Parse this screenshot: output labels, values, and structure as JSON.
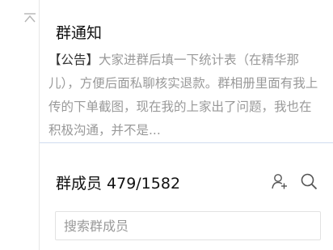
{
  "notice": {
    "title": "群通知",
    "tag": "【公告】",
    "body": "大家进群后填一下统计表（在精华那儿），方便后面私聊核实退款。群相册里面有我上传的下单截图，现在我的上家出了问题，我也在积极沟通，并不是..."
  },
  "members": {
    "label": "群成员",
    "count": "479/1582",
    "search_placeholder": "搜索群成员"
  },
  "icons": {
    "collapse": "chevron-up-icon",
    "add_member": "add-user-icon",
    "search": "search-icon"
  },
  "colors": {
    "text_primary": "#111111",
    "text_muted": "#999999",
    "divider": "#cfdcef",
    "icon": "#555555"
  }
}
